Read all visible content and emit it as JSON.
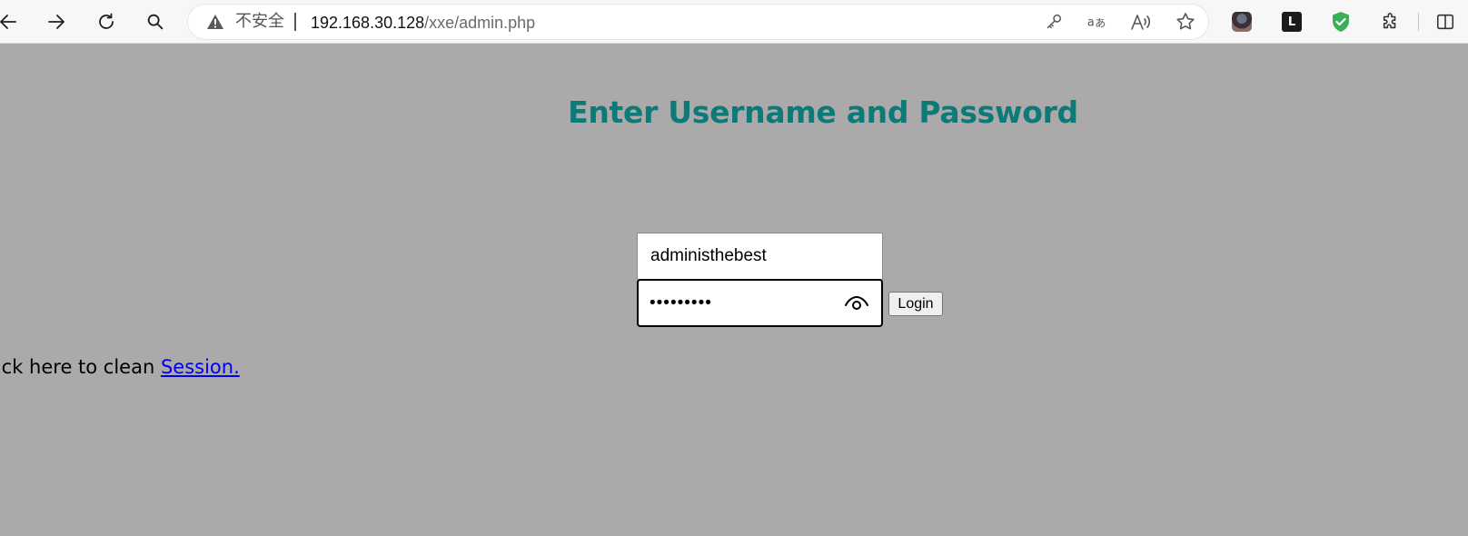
{
  "browser": {
    "back_icon": "arrow-left-icon",
    "forward_icon": "arrow-right-icon",
    "refresh_icon": "refresh-icon",
    "search_icon": "search-icon",
    "security_label": "不安全",
    "url_host": "192.168.30.128",
    "url_path": "/xxe/admin.php",
    "address_icons": [
      "key-icon",
      "translate-icon",
      "read-aloud-icon",
      "favorite-star-icon"
    ],
    "toolbar_icons": [
      "profile-avatar-icon",
      "extension-l-icon",
      "shield-extension-icon",
      "extensions-puzzle-icon",
      "split-screen-icon"
    ],
    "extension_letter": "L"
  },
  "page": {
    "background": "#aba9aa",
    "heading": "Enter Username and Password",
    "heading_color": "#0c7a77",
    "username_value": "administhebest",
    "password_value": "123456789",
    "login_label": "Login",
    "session_text": "lick here to clean ",
    "session_link": "Session."
  }
}
